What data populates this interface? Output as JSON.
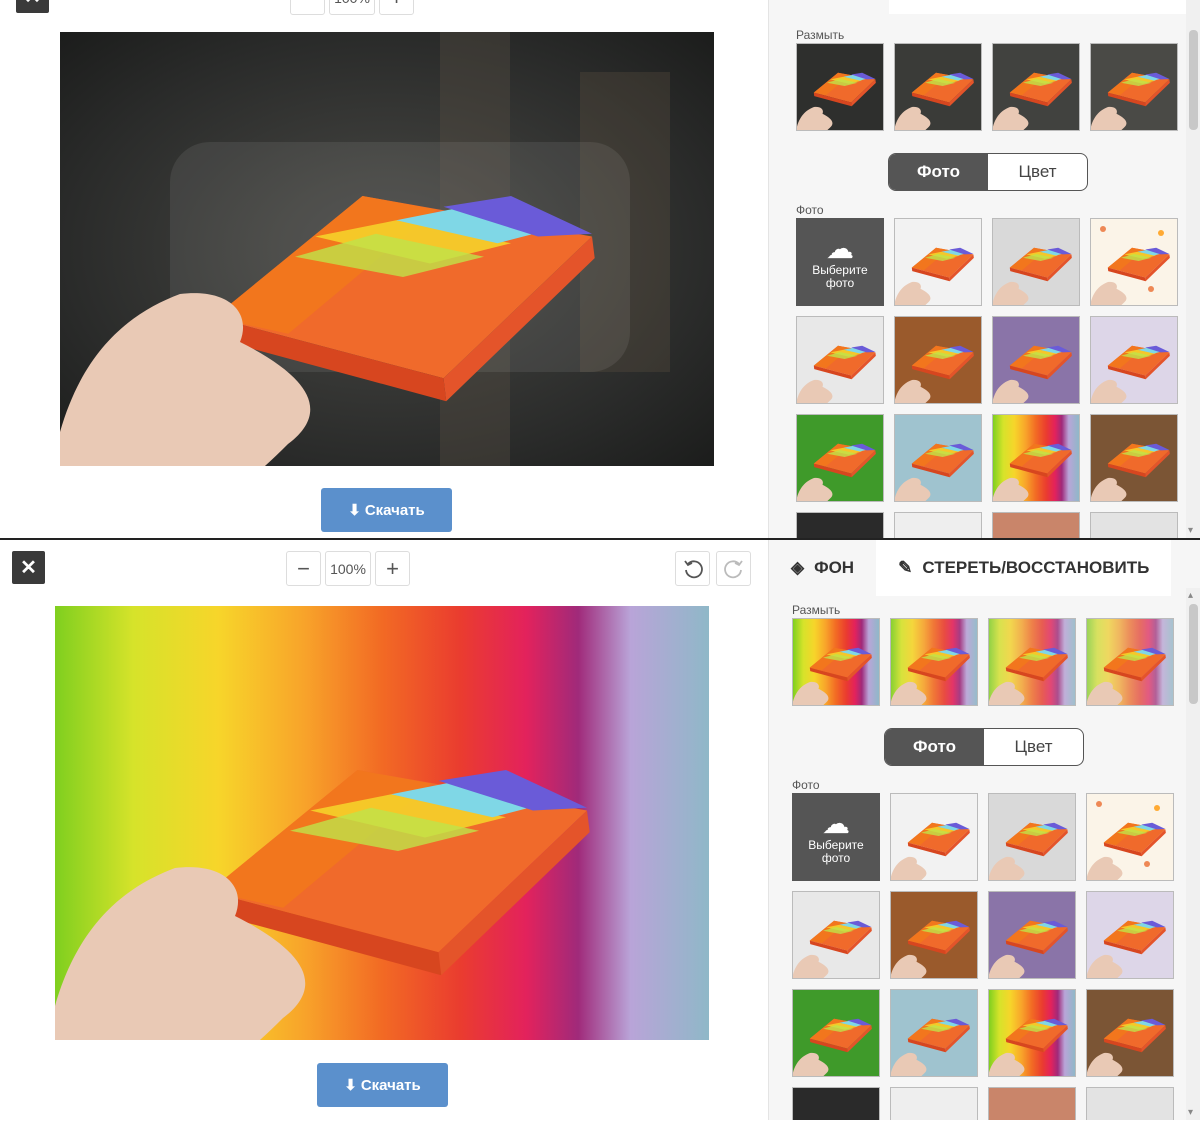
{
  "editor": {
    "zoom_value": "100%",
    "download_label": "Скачать",
    "close_icon": "close-icon"
  },
  "sidebar": {
    "tab_background": "ФОН",
    "tab_erase": "СТЕРЕТЬ/ВОССТАНОВИТЬ",
    "blur_label": "Размыть",
    "segment_photo": "Фото",
    "segment_color": "Цвет",
    "photo_label": "Фото",
    "upload_label_line1": "Выберите",
    "upload_label_line2": "фото"
  },
  "colors": {
    "accent_button": "#5b90cc",
    "close_button": "#3a3a3a",
    "segment_active": "#555555"
  }
}
